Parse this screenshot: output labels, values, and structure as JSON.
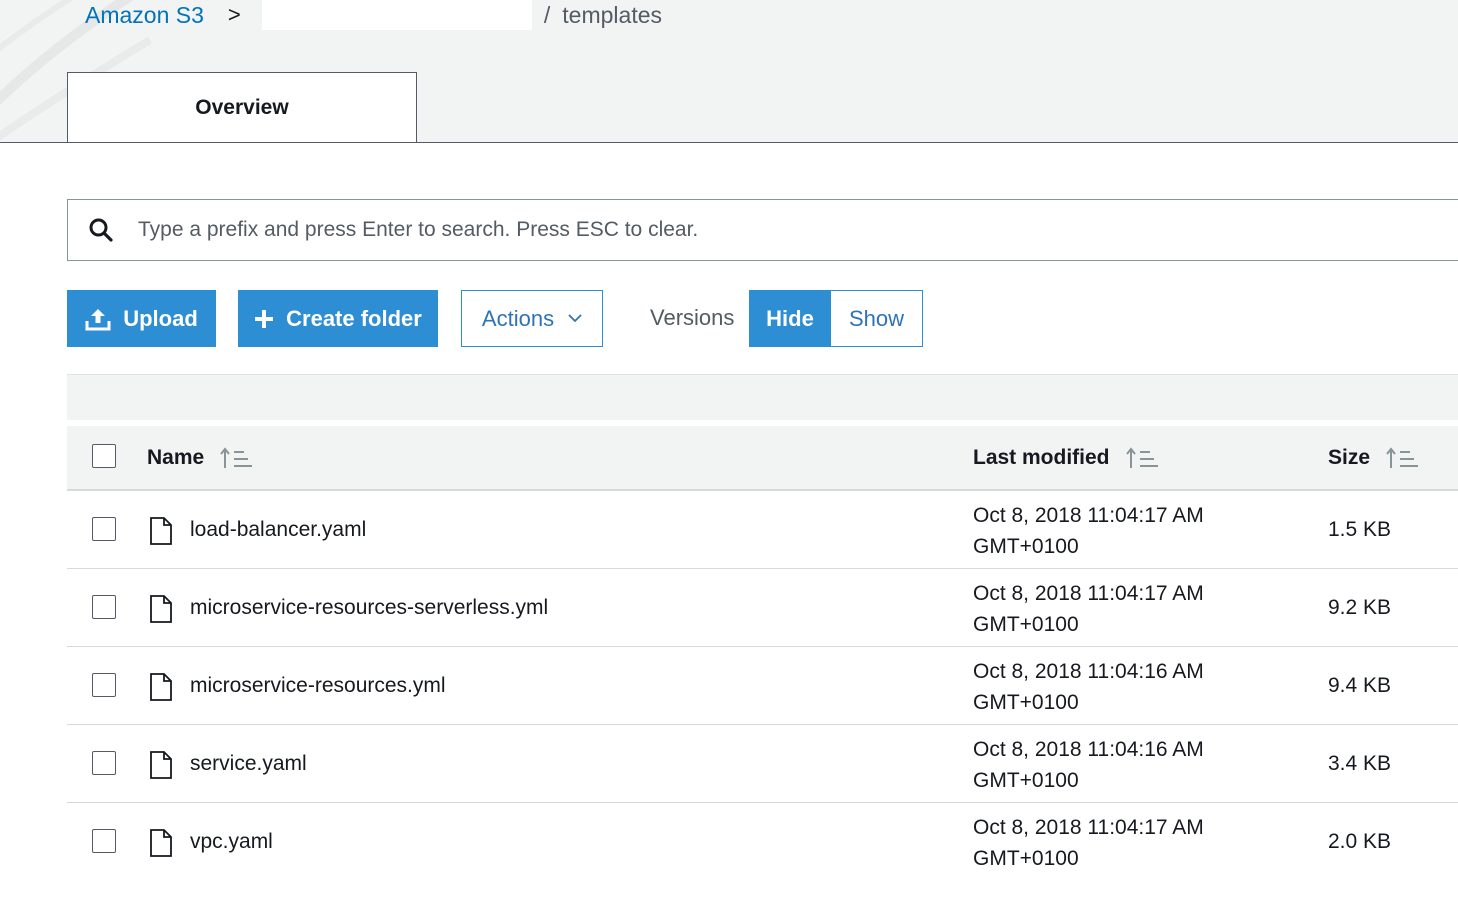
{
  "breadcrumb": {
    "root": "Amazon S3",
    "separator": ">",
    "slash": "/",
    "current": "templates"
  },
  "tabs": [
    {
      "label": "Overview",
      "active": true
    }
  ],
  "search": {
    "placeholder": "Type a prefix and press Enter to search. Press ESC to clear.",
    "value": ""
  },
  "toolbar": {
    "upload_label": "Upload",
    "create_folder_label": "Create folder",
    "actions_label": "Actions",
    "versions_label": "Versions",
    "hide_label": "Hide",
    "show_label": "Show",
    "versions_selected": "Hide"
  },
  "table": {
    "columns": {
      "name": "Name",
      "last_modified": "Last modified",
      "size": "Size"
    },
    "rows": [
      {
        "name": "load-balancer.yaml",
        "date_line1": "Oct 8, 2018 11:04:17 AM",
        "date_line2": "GMT+0100",
        "size": "1.5 KB"
      },
      {
        "name": "microservice-resources-serverless.yml",
        "date_line1": "Oct 8, 2018 11:04:17 AM",
        "date_line2": "GMT+0100",
        "size": "9.2 KB"
      },
      {
        "name": "microservice-resources.yml",
        "date_line1": "Oct 8, 2018 11:04:16 AM",
        "date_line2": "GMT+0100",
        "size": "9.4 KB"
      },
      {
        "name": "service.yaml",
        "date_line1": "Oct 8, 2018 11:04:16 AM",
        "date_line2": "GMT+0100",
        "size": "3.4 KB"
      },
      {
        "name": "vpc.yaml",
        "date_line1": "Oct 8, 2018 11:04:17 AM",
        "date_line2": "GMT+0100",
        "size": "2.0 KB"
      }
    ]
  },
  "colors": {
    "accent": "#2e8ed4",
    "link": "#0073bb",
    "header_bg": "#f2f3f3"
  },
  "icons": [
    "search-icon",
    "upload-icon",
    "plus-icon",
    "chevron-down-icon",
    "sort-icon",
    "file-icon"
  ]
}
